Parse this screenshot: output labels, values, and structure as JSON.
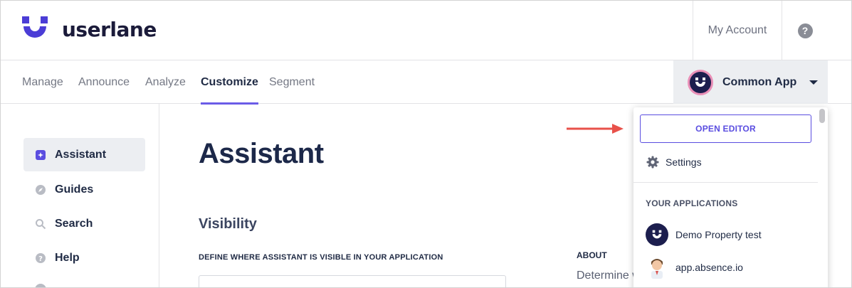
{
  "header": {
    "logo_text": "userlane",
    "account_label": "My Account",
    "help_glyph": "?"
  },
  "nav": {
    "tabs": [
      {
        "label": "Manage"
      },
      {
        "label": "Announce"
      },
      {
        "label": "Analyze"
      },
      {
        "label": "Customize",
        "active": true
      },
      {
        "label": "Segment"
      }
    ],
    "app_switcher": {
      "label": "Common App"
    }
  },
  "sidebar": {
    "items": [
      {
        "label": "Assistant",
        "icon": "assistant-icon",
        "active": true
      },
      {
        "label": "Guides",
        "icon": "compass-icon"
      },
      {
        "label": "Search",
        "icon": "search-icon"
      },
      {
        "label": "Help",
        "icon": "help-icon"
      }
    ]
  },
  "main": {
    "title": "Assistant",
    "section_title": "Visibility",
    "define_label": "DEFINE WHERE ASSISTANT IS VISIBLE IN YOUR APPLICATION",
    "about_label": "ABOUT",
    "about_text": "Determine w"
  },
  "dropdown": {
    "open_editor_label": "OPEN EDITOR",
    "settings_label": "Settings",
    "apps_header": "YOUR APPLICATIONS",
    "apps": [
      {
        "label": "Demo Property test",
        "icon": "userlane-app-icon"
      },
      {
        "label": "app.absence.io",
        "icon": "person-avatar-icon"
      }
    ]
  },
  "colors": {
    "accent": "#6b5ce7",
    "brand": "#4b3dd6",
    "annotation_arrow": "#e8514a"
  }
}
